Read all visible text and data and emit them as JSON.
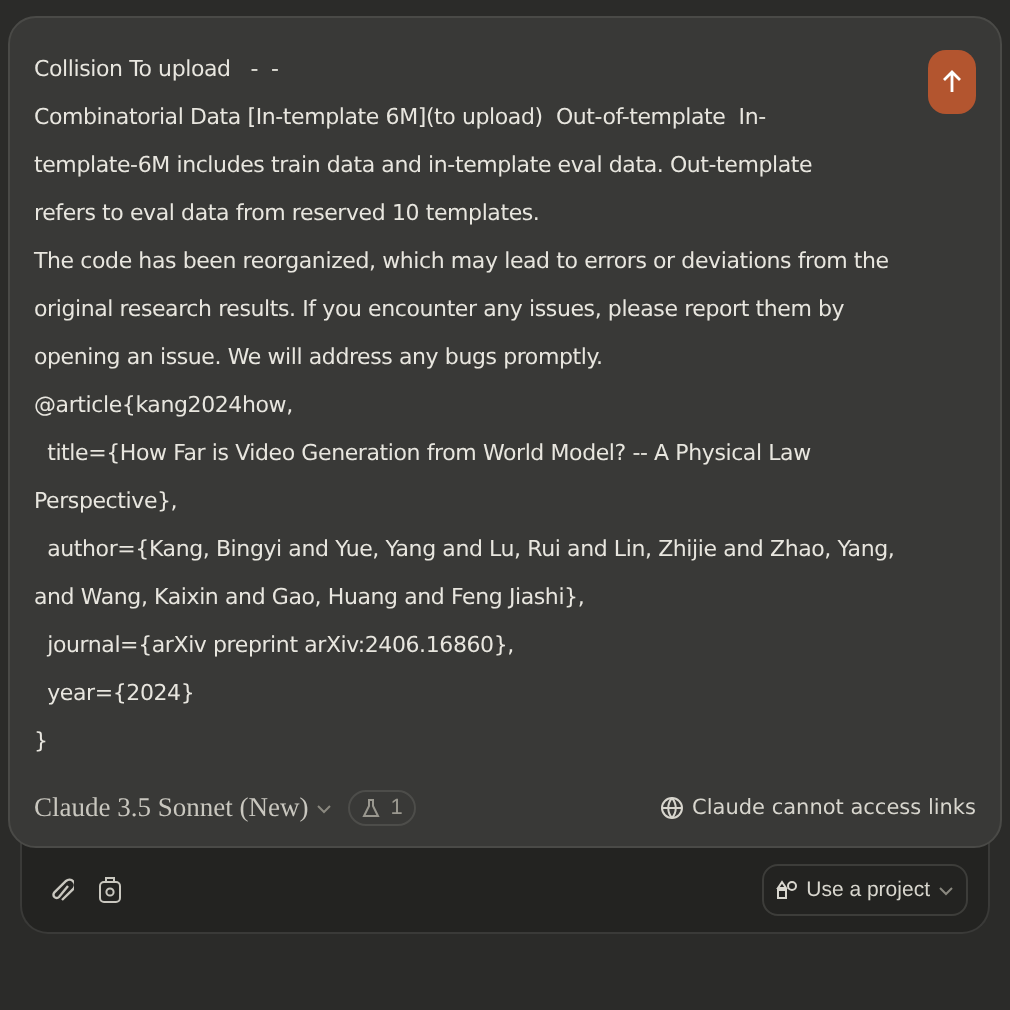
{
  "message_lines": [
    "Collision To upload   -  -",
    "Combinatorial Data [In-template 6M](to upload)  Out-of-template  In-",
    "template-6M includes train data and in-template eval data. Out-template",
    "refers to eval data from reserved 10 templates.",
    "The code has been reorganized, which may lead to errors or deviations from the",
    "original research results. If you encounter any issues, please report them by",
    "opening an issue. We will address any bugs promptly.",
    "@article{kang2024how,",
    "  title={How Far is Video Generation from World Model? -- A Physical Law",
    "Perspective},",
    "  author={Kang, Bingyi and Yue, Yang and Lu, Rui and Lin, Zhijie and Zhao, Yang,",
    "and Wang, Kaixin and Gao, Huang and Feng Jiashi},",
    "  journal={arXiv preprint arXiv:2406.16860},",
    "  year={2024}",
    "}"
  ],
  "model": {
    "name": "Claude 3.5 Sonnet (New)"
  },
  "styles_badge": {
    "count": "1"
  },
  "links_notice": "Claude cannot access links",
  "project_button": {
    "label": "Use a project"
  }
}
